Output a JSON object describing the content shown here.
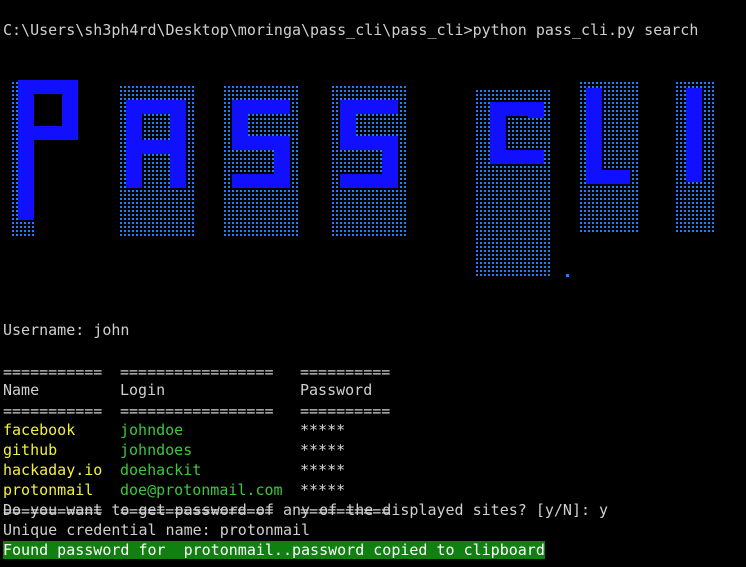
{
  "prompt": "C:\\Users\\sh3ph4rd\\Desktop\\moringa\\pass_cli\\pass_cli>python pass_cli.py search",
  "banner": {
    "text": "PASS CLI",
    "color": "#1010ff",
    "drip_color": "#1e7fff"
  },
  "username_line": "Username: john",
  "separator": {
    "name": "===========",
    "login": "=================",
    "password": "=========="
  },
  "headers": {
    "name": "Name",
    "login": "Login",
    "password": "Password"
  },
  "rows": [
    {
      "name": "facebook",
      "login": "johndoe",
      "password": "*****"
    },
    {
      "name": "github",
      "login": "johndoes",
      "password": "*****"
    },
    {
      "name": "hackaday.io",
      "login": "doehackit",
      "password": "*****"
    },
    {
      "name": "protonmail",
      "login": "doe@protonmail.com",
      "password": "*****"
    }
  ],
  "question": "Do you want to get password of any of the displayed sites? [y/N]: y",
  "credential_prompt": "Unique credential name: protonmail",
  "found_message": "Found password for  protonmail..password copied to clipboard",
  "colors": {
    "site_name": "#f2f23a",
    "login": "#3cc83c",
    "highlight_bg": "#108010"
  }
}
